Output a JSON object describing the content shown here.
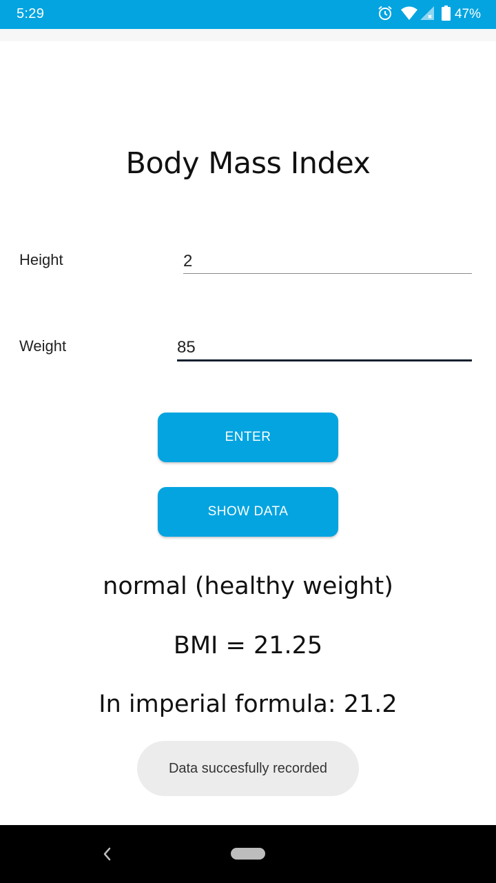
{
  "status_bar": {
    "time": "5:29",
    "battery": "47%",
    "icons": [
      "alarm-icon",
      "wifi-icon",
      "signal-icon",
      "battery-icon"
    ],
    "color": "#03a4e0"
  },
  "page": {
    "title": "Body Mass Index"
  },
  "form": {
    "height_label": "Height",
    "height_value": "2",
    "weight_label": "Weight",
    "weight_value": "85"
  },
  "buttons": {
    "enter_label": "ENTER",
    "show_data_label": "SHOW DATA",
    "color": "#03a4e0"
  },
  "results": {
    "category": "normal (healthy weight)",
    "bmi": "BMI = 21.25",
    "imperial": "In imperial formula: 21.2"
  },
  "toast": {
    "message": "Data succesfully recorded"
  },
  "nav_bar": {
    "icons": [
      "back-icon",
      "home-pill-icon"
    ]
  }
}
